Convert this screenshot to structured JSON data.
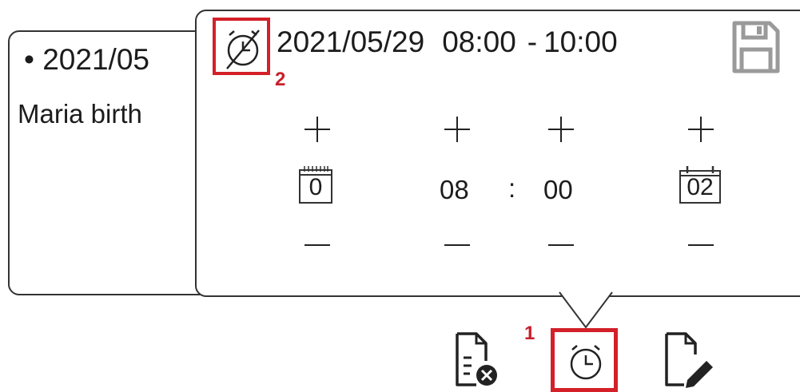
{
  "background_event": {
    "date": "2021/05",
    "title": "Maria birth"
  },
  "popover": {
    "header": {
      "date": "2021/05/29",
      "start_time": "08:00",
      "separator": "-",
      "end_time": "10:00"
    },
    "columns": {
      "days": {
        "value": "0"
      },
      "hour": {
        "value": "08"
      },
      "colon": ":",
      "minute": {
        "value": "00"
      },
      "duration": {
        "value": "02"
      }
    },
    "step_badge": "2"
  },
  "toolbar": {
    "step_badge": "1"
  },
  "icons": {
    "alarm_off": "alarm-off-icon",
    "save": "save-icon",
    "delete": "delete-document-icon",
    "alarm": "alarm-clock-icon",
    "edit": "edit-document-icon"
  },
  "colors": {
    "highlight": "#d32029",
    "badge": "#c8202a",
    "ink": "#1c1c1c",
    "icon_gray": "#9a9a9a"
  }
}
